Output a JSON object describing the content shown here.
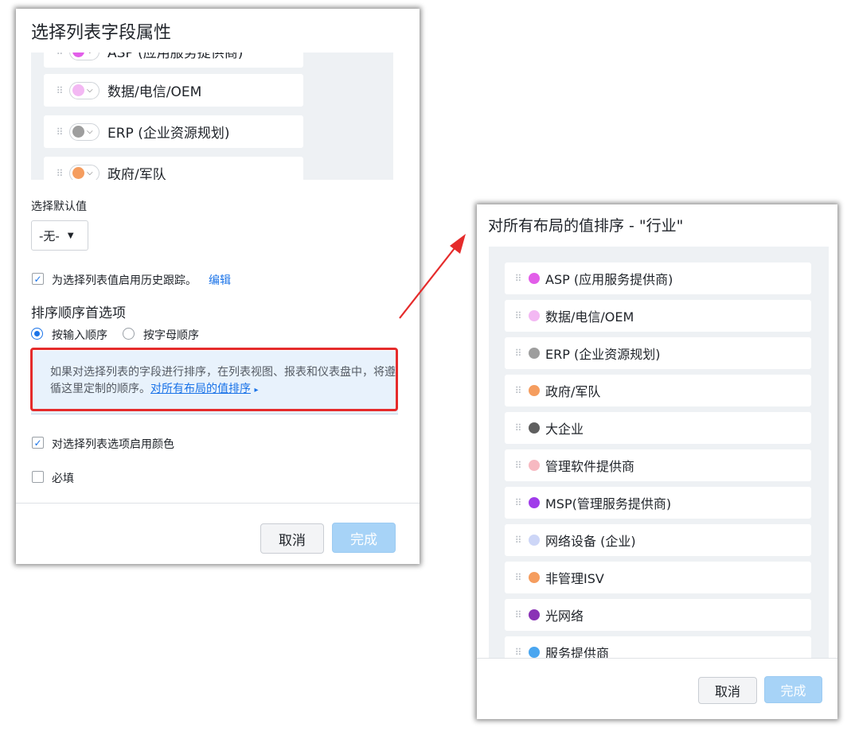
{
  "dialog1": {
    "title": "选择列表字段属性",
    "picklist_items": [
      {
        "label": "ASP (应用服务提供商)",
        "color": "#e25ee9"
      },
      {
        "label": "数据/电信/OEM",
        "color": "#f3b8f3"
      },
      {
        "label": "ERP (企业资源规划)",
        "color": "#9e9e9e"
      },
      {
        "label": "政府/军队",
        "color": "#f59d5f"
      }
    ],
    "default_value_label": "选择默认值",
    "default_value_selected": "-无-",
    "history_tracking_label": "为选择列表值启用历史跟踪。",
    "history_tracking_checked": true,
    "edit_link": "编辑",
    "sort_heading": "排序顺序首选项",
    "sort_options": [
      "按输入顺序",
      "按字母顺序"
    ],
    "sort_selected": "按输入顺序",
    "info_text": "如果对选择列表的字段进行排序，在列表视图、报表和仪表盘中，将遵循这里定制的顺序。",
    "info_link": "对所有布局的值排序",
    "enable_color_label": "对选择列表选项启用颜色",
    "enable_color_checked": true,
    "required_label": "必填",
    "required_checked": false,
    "cancel_label": "取消",
    "done_label": "完成"
  },
  "dialog2": {
    "title": "对所有布局的值排序 - \"行业\"",
    "items": [
      {
        "label": "ASP (应用服务提供商)",
        "color": "#e25ee9"
      },
      {
        "label": "数据/电信/OEM",
        "color": "#f3b8f3"
      },
      {
        "label": "ERP (企业资源规划)",
        "color": "#9e9e9e"
      },
      {
        "label": "政府/军队",
        "color": "#f59d5f"
      },
      {
        "label": "大企业",
        "color": "#5f5f5f"
      },
      {
        "label": "管理软件提供商",
        "color": "#f7b9c1"
      },
      {
        "label": "MSP(管理服务提供商)",
        "color": "#a03cea"
      },
      {
        "label": "网络设备 (企业)",
        "color": "#cdd6f7"
      },
      {
        "label": "非管理ISV",
        "color": "#f59d5f"
      },
      {
        "label": "光网络",
        "color": "#8a32b6"
      },
      {
        "label": "服务提供商",
        "color": "#4aa6f0"
      }
    ],
    "cancel_label": "取消",
    "done_label": "完成"
  },
  "colors": {
    "accent": "#1a73e8",
    "annotation_red": "#e52b2b",
    "panel_bg": "#eef1f4"
  },
  "icons": {
    "drag_handle": "drag-handle-icon",
    "checkbox": "checkmark-icon",
    "caret": "caret-down-icon"
  }
}
